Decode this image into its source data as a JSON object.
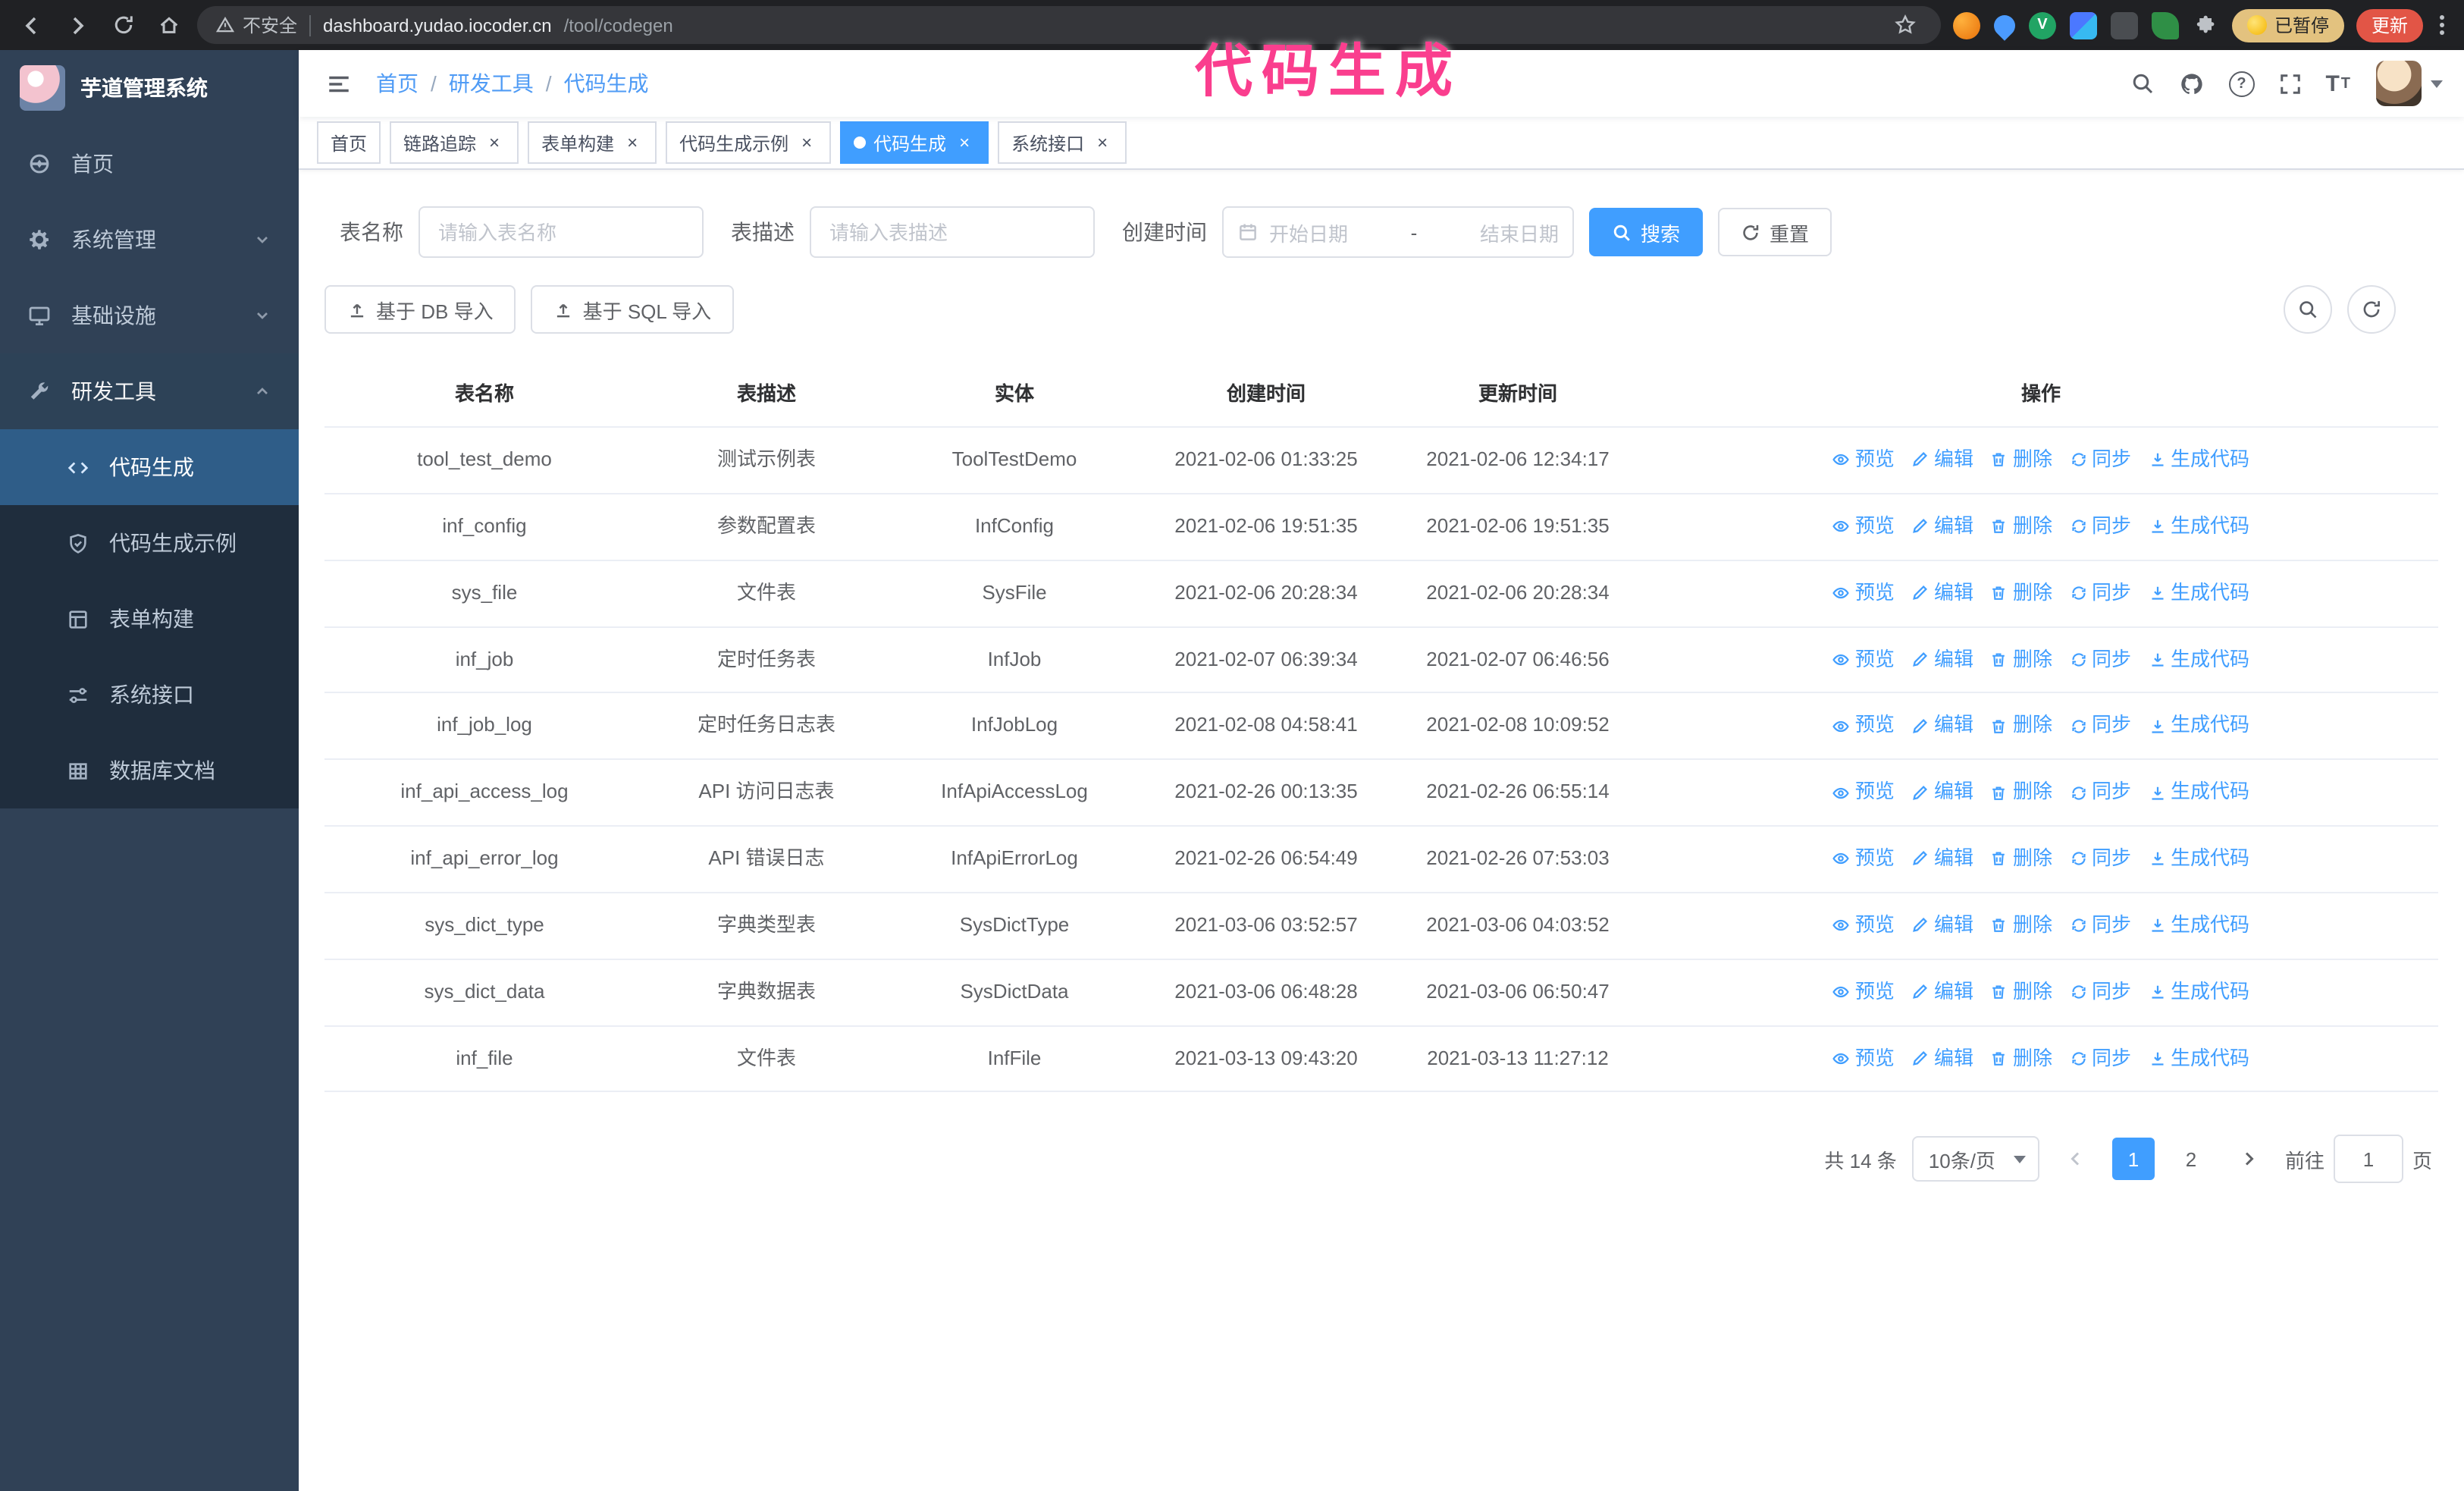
{
  "colors": {
    "accent": "#409eff",
    "sidebar_bg": "#304156",
    "submenu_bg": "#1f2d3d",
    "annotation": "#fa3e8e"
  },
  "annotation": {
    "text": "代码生成",
    "color": "#fa3e8e"
  },
  "browser": {
    "security_label": "不安全",
    "url_host": "dashboard.yudao.iocoder.cn",
    "url_path": "/tool/codegen",
    "vue_badge": "V",
    "paused_badge": "已暂停",
    "update_button": "更新"
  },
  "sidebar": {
    "logo_title": "芋道管理系统",
    "items": [
      {
        "label": "首页",
        "icon": "home-icon"
      },
      {
        "label": "系统管理",
        "icon": "gear-icon"
      },
      {
        "label": "基础设施",
        "icon": "monitor-icon"
      },
      {
        "label": "研发工具",
        "icon": "wrench-icon"
      }
    ],
    "sub_items": [
      {
        "label": "代码生成",
        "icon": "code-icon",
        "active": true
      },
      {
        "label": "代码生成示例",
        "icon": "shield-icon"
      },
      {
        "label": "表单构建",
        "icon": "form-icon"
      },
      {
        "label": "系统接口",
        "icon": "sliders-icon"
      },
      {
        "label": "数据库文档",
        "icon": "table-grid-icon"
      }
    ]
  },
  "navbar": {
    "breadcrumb": [
      "首页",
      "研发工具",
      "代码生成"
    ],
    "separator": "/"
  },
  "tabs": [
    {
      "label": "首页",
      "closable": false,
      "active": false
    },
    {
      "label": "链路追踪",
      "closable": true,
      "active": false
    },
    {
      "label": "表单构建",
      "closable": true,
      "active": false
    },
    {
      "label": "代码生成示例",
      "closable": true,
      "active": false
    },
    {
      "label": "代码生成",
      "closable": true,
      "active": true
    },
    {
      "label": "系统接口",
      "closable": true,
      "active": false
    }
  ],
  "filters": {
    "table_name_label": "表名称",
    "table_name_placeholder": "请输入表名称",
    "table_desc_label": "表描述",
    "table_desc_placeholder": "请输入表描述",
    "create_time_label": "创建时间",
    "date_start_placeholder": "开始日期",
    "date_separator": "-",
    "date_end_placeholder": "结束日期",
    "search_button": "搜索",
    "reset_button": "重置"
  },
  "toolbar": {
    "import_db_button": "基于 DB 导入",
    "import_sql_button": "基于 SQL 导入"
  },
  "table": {
    "columns": [
      "表名称",
      "表描述",
      "实体",
      "创建时间",
      "更新时间",
      "操作"
    ],
    "row_actions": [
      {
        "name": "preview-action",
        "label": "预览",
        "icon": "eye-icon"
      },
      {
        "name": "edit-action",
        "label": "编辑",
        "icon": "edit-icon"
      },
      {
        "name": "delete-action",
        "label": "删除",
        "icon": "delete-icon"
      },
      {
        "name": "sync-action",
        "label": "同步",
        "icon": "sync-icon"
      },
      {
        "name": "generate-code-action",
        "label": "生成代码",
        "icon": "generate-code-icon"
      }
    ],
    "rows": [
      {
        "name": "tool_test_demo",
        "desc": "测试示例表",
        "entity": "ToolTestDemo",
        "create_time": "2021-02-06 01:33:25",
        "update_time": "2021-02-06 12:34:17"
      },
      {
        "name": "inf_config",
        "desc": "参数配置表",
        "entity": "InfConfig",
        "create_time": "2021-02-06 19:51:35",
        "update_time": "2021-02-06 19:51:35"
      },
      {
        "name": "sys_file",
        "desc": "文件表",
        "entity": "SysFile",
        "create_time": "2021-02-06 20:28:34",
        "update_time": "2021-02-06 20:28:34"
      },
      {
        "name": "inf_job",
        "desc": "定时任务表",
        "entity": "InfJob",
        "create_time": "2021-02-07 06:39:34",
        "update_time": "2021-02-07 06:46:56"
      },
      {
        "name": "inf_job_log",
        "desc": "定时任务日志表",
        "entity": "InfJobLog",
        "create_time": "2021-02-08 04:58:41",
        "update_time": "2021-02-08 10:09:52"
      },
      {
        "name": "inf_api_access_log",
        "desc": "API 访问日志表",
        "entity": "InfApiAccessLog",
        "create_time": "2021-02-26 00:13:35",
        "update_time": "2021-02-26 06:55:14"
      },
      {
        "name": "inf_api_error_log",
        "desc": "API 错误日志",
        "entity": "InfApiErrorLog",
        "create_time": "2021-02-26 06:54:49",
        "update_time": "2021-02-26 07:53:03"
      },
      {
        "name": "sys_dict_type",
        "desc": "字典类型表",
        "entity": "SysDictType",
        "create_time": "2021-03-06 03:52:57",
        "update_time": "2021-03-06 04:03:52"
      },
      {
        "name": "sys_dict_data",
        "desc": "字典数据表",
        "entity": "SysDictData",
        "create_time": "2021-03-06 06:48:28",
        "update_time": "2021-03-06 06:50:47"
      },
      {
        "name": "inf_file",
        "desc": "文件表",
        "entity": "InfFile",
        "create_time": "2021-03-13 09:43:20",
        "update_time": "2021-03-13 11:27:12"
      }
    ]
  },
  "pagination": {
    "total_text": "共 14 条",
    "page_size": "10条/页",
    "pages": [
      "1",
      "2"
    ],
    "current_page": "1",
    "goto_prefix": "前往",
    "goto_value": "1",
    "goto_suffix": "页"
  }
}
